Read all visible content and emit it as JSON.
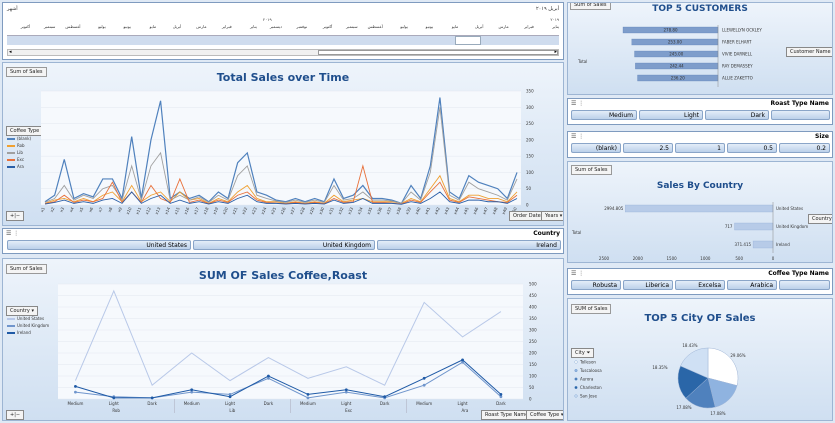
{
  "timeline": {
    "level_label": "أشهر",
    "range_label": "أبريل ٢٠١٩",
    "year_label_mid": "٢٠١٩",
    "year_label_right": "٢٠١٩",
    "months": [
      "يناير",
      "فبراير",
      "مارس",
      "أبريل",
      "مايو",
      "يونيو",
      "يوليو",
      "أغسطس",
      "سبتمبر",
      "أكتوبر",
      "نوفمبر",
      "ديسمبر",
      "يناير",
      "فبراير",
      "مارس",
      "أبريل",
      "مايو",
      "يونيو",
      "يوليو",
      "أغسطس",
      "سبتمبر",
      "أكتوبر"
    ]
  },
  "sales_over_time": {
    "field_button": "Sum of Sales",
    "title": "Total Sales over Time",
    "legend_button": "Coffee Type",
    "legend": [
      {
        "name": "(blank)",
        "color": "#4f81bd"
      },
      {
        "name": "Rob",
        "color": "#f0a030"
      },
      {
        "name": "Lib",
        "color": "#a0a0a0"
      },
      {
        "name": "Exc",
        "color": "#e8703a"
      },
      {
        "name": "Ara",
        "color": "#2a5fa8"
      }
    ],
    "axis_filters": [
      "Order Date",
      "Years"
    ]
  },
  "chart_data": [
    {
      "type": "line",
      "title": "Total Sales over Time",
      "ylim": [
        0,
        350
      ],
      "yticks": [
        0,
        50,
        100,
        150,
        200,
        250,
        300,
        350
      ],
      "x": [
        "1",
        "2",
        "3",
        "4",
        "5",
        "6",
        "7",
        "8",
        "9",
        "10",
        "11",
        "12",
        "13",
        "14",
        "15",
        "16",
        "17",
        "18",
        "19",
        "20",
        "21",
        "22",
        "23",
        "24",
        "25",
        "26",
        "27",
        "28",
        "29",
        "30",
        "31",
        "32",
        "33",
        "34",
        "35",
        "36",
        "37",
        "38",
        "39",
        "40",
        "41",
        "42",
        "43",
        "44",
        "45",
        "46",
        "47",
        "48",
        "49",
        "50"
      ],
      "series": [
        {
          "name": "(blank)",
          "color": "#4f81bd",
          "values": [
            10,
            30,
            140,
            20,
            35,
            25,
            80,
            80,
            20,
            210,
            20,
            200,
            320,
            20,
            40,
            20,
            30,
            10,
            40,
            20,
            130,
            160,
            40,
            30,
            15,
            10,
            20,
            10,
            20,
            10,
            80,
            20,
            30,
            60,
            20,
            20,
            15,
            5,
            60,
            20,
            120,
            330,
            40,
            20,
            90,
            70,
            60,
            50,
            20,
            100
          ]
        },
        {
          "name": "Rob",
          "color": "#f0a030",
          "values": [
            5,
            15,
            20,
            10,
            20,
            10,
            30,
            40,
            10,
            60,
            10,
            30,
            40,
            10,
            40,
            15,
            20,
            5,
            20,
            10,
            40,
            60,
            20,
            10,
            10,
            5,
            10,
            5,
            10,
            5,
            30,
            10,
            15,
            20,
            10,
            10,
            10,
            5,
            20,
            10,
            50,
            90,
            20,
            10,
            30,
            30,
            20,
            20,
            10,
            40
          ]
        },
        {
          "name": "Lib",
          "color": "#a0a0a0",
          "values": [
            8,
            20,
            60,
            15,
            30,
            20,
            50,
            60,
            15,
            120,
            15,
            120,
            160,
            15,
            30,
            15,
            25,
            8,
            30,
            15,
            90,
            120,
            30,
            20,
            12,
            8,
            15,
            8,
            15,
            8,
            60,
            15,
            20,
            40,
            15,
            15,
            12,
            5,
            40,
            15,
            100,
            300,
            30,
            15,
            70,
            50,
            40,
            30,
            15,
            80
          ]
        },
        {
          "name": "Exc",
          "color": "#e8703a",
          "values": [
            4,
            10,
            30,
            8,
            15,
            10,
            20,
            70,
            8,
            40,
            8,
            60,
            20,
            8,
            80,
            8,
            15,
            4,
            15,
            8,
            30,
            40,
            15,
            8,
            6,
            4,
            8,
            4,
            8,
            4,
            20,
            8,
            10,
            120,
            8,
            8,
            6,
            3,
            15,
            8,
            40,
            70,
            15,
            8,
            25,
            20,
            15,
            10,
            8,
            30
          ]
        },
        {
          "name": "Ara",
          "color": "#2a5fa8",
          "values": [
            3,
            8,
            15,
            5,
            10,
            5,
            15,
            20,
            5,
            40,
            5,
            20,
            30,
            5,
            15,
            5,
            10,
            3,
            10,
            5,
            20,
            30,
            10,
            5,
            5,
            3,
            5,
            3,
            5,
            3,
            15,
            5,
            8,
            20,
            5,
            5,
            5,
            2,
            10,
            5,
            20,
            40,
            10,
            5,
            15,
            15,
            10,
            10,
            5,
            20
          ]
        }
      ]
    },
    {
      "type": "line",
      "title": "SUM OF Sales Coffee,Roast",
      "ylim": [
        0,
        500
      ],
      "yticks": [
        0,
        50,
        100,
        150,
        200,
        250,
        300,
        350,
        400,
        450,
        500
      ],
      "categories": [
        "Medium",
        "Light",
        "Dark",
        "Medium",
        "Light",
        "Dark",
        "Medium",
        "Light",
        "Dark",
        "Medium",
        "Light",
        "Dark"
      ],
      "groups": [
        "Rob",
        "Lib",
        "Exc",
        "Ara"
      ],
      "series": [
        {
          "name": "United States",
          "color": "#b8c8e8",
          "values": [
            80,
            470,
            60,
            200,
            80,
            180,
            90,
            140,
            60,
            420,
            270,
            380
          ]
        },
        {
          "name": "United Kingdom",
          "color": "#6f95cc",
          "values": [
            30,
            10,
            5,
            30,
            20,
            90,
            5,
            30,
            5,
            60,
            160,
            10
          ]
        },
        {
          "name": "Ireland",
          "color": "#1f5aa6",
          "values": [
            55,
            5,
            5,
            40,
            10,
            100,
            20,
            40,
            10,
            90,
            170,
            20
          ]
        }
      ]
    },
    {
      "type": "bar",
      "title": "TOP 5 CUSTOMERS",
      "categories": [
        "LLEWELLYN OCKLEY",
        "FABER ELHART",
        "VIVIE DARNELL",
        "RAY DEMASSEY",
        "ALLIE ZAKETTO"
      ],
      "values": [
        278.8,
        253.0,
        245.0,
        242.44,
        236.2
      ],
      "value_labels": [
        "278.80",
        "253.00",
        "245.00",
        "242.44",
        "236.20"
      ],
      "row_label": "Total",
      "filter_button": "Customer Name"
    },
    {
      "type": "bar",
      "title": "Sales By Country",
      "categories": [
        "United States",
        "United Kingdom",
        "Ireland"
      ],
      "values": [
        2994.805,
        717,
        371.415
      ],
      "value_labels": [
        "2994.805",
        "717",
        "371.415"
      ],
      "xticks": [
        "2500",
        "2000",
        "1500",
        "1000",
        "500",
        "0"
      ],
      "row_label": "Total",
      "filter_button": "Country"
    },
    {
      "type": "pie",
      "title": "TOP 5 City OF Sales",
      "slice_labels": [
        "Tolleson",
        "Tuscaloosa",
        "Aurora",
        "Charleston",
        "San Jose"
      ],
      "values": [
        29.06,
        17.08,
        17.08,
        18.35,
        18.43
      ],
      "value_labels": [
        "29.06%",
        "17.08%",
        "17.08%",
        "18.35%",
        "18.43%"
      ],
      "colors": [
        "#ffffff",
        "#8fb3e0",
        "#4f81bd",
        "#2a66a8",
        "#cfe0f4"
      ],
      "filter_button": "City"
    }
  ],
  "customers": {
    "field_button": "Sum of Sales",
    "title": "TOP 5 CUSTOMERS"
  },
  "roast_slicer": {
    "header": "Roast Type Name",
    "items": [
      "Medium",
      "Light",
      "Dark",
      ""
    ]
  },
  "size_slicer": {
    "header": "Size",
    "items": [
      "(blank)",
      "2.5",
      "1",
      "0.5",
      "0.2"
    ]
  },
  "country_slicer": {
    "header": "Country",
    "items": [
      "United States",
      "United Kingdom",
      "Ireland"
    ]
  },
  "country_chart": {
    "field_button": "Sum of Sales",
    "title": "Sales By Country"
  },
  "coffee_slicer": {
    "header": "Coffee Type Name",
    "items": [
      "Robusta",
      "Liberica",
      "Excelsa",
      "Arabica",
      ""
    ]
  },
  "city_chart": {
    "field_button": "SUM of Sales",
    "title": "TOP 5 City OF Sales"
  },
  "coffee_roast": {
    "field_button": "Sum of Sales",
    "title": "SUM OF Sales Coffee,Roast",
    "legend_button": "Country",
    "legend": [
      {
        "name": "United States",
        "color": "#b8c8e8"
      },
      {
        "name": "United Kingdom",
        "color": "#6f95cc"
      },
      {
        "name": "Ireland",
        "color": "#1f5aa6"
      }
    ],
    "group_labels": [
      "Rob",
      "Lib",
      "Exc",
      "Ara"
    ],
    "axis_filters": [
      "Roast Type Name",
      "Coffee Type"
    ]
  }
}
